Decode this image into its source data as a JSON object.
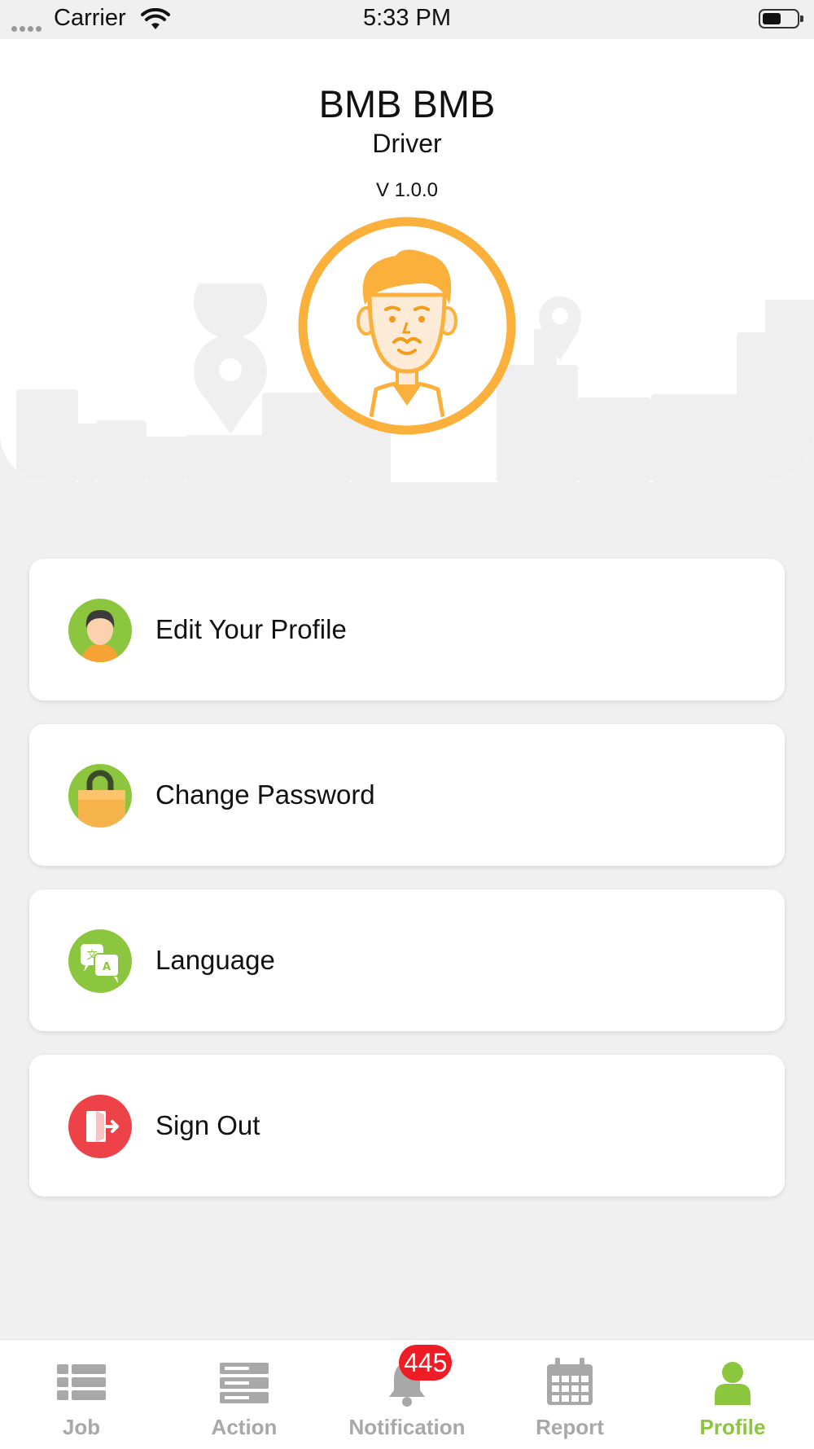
{
  "status_bar": {
    "carrier": "Carrier",
    "time": "5:33 PM"
  },
  "profile": {
    "name": "BMB BMB",
    "role": "Driver",
    "version": "V 1.0.0"
  },
  "menu": [
    {
      "label": "Edit Your Profile",
      "icon": "user-face-icon",
      "color": "#8cc63e"
    },
    {
      "label": "Change Password",
      "icon": "lock-icon",
      "color": "#8cc63e"
    },
    {
      "label": "Language",
      "icon": "translate-icon",
      "color": "#8cc63e"
    },
    {
      "label": "Sign Out",
      "icon": "sign-out-icon",
      "color": "#ee4249"
    }
  ],
  "tabs": [
    {
      "label": "Job",
      "icon": "list-icon",
      "active": false
    },
    {
      "label": "Action",
      "icon": "server-icon",
      "active": false
    },
    {
      "label": "Notification",
      "icon": "bell-icon",
      "active": false,
      "badge": "445"
    },
    {
      "label": "Report",
      "icon": "calendar-icon",
      "active": false
    },
    {
      "label": "Profile",
      "icon": "person-icon",
      "active": true
    }
  ],
  "colors": {
    "accent": "#8cc63e",
    "avatar_ring": "#fbb03b",
    "danger": "#ee4249",
    "badge": "#ee1c24"
  }
}
